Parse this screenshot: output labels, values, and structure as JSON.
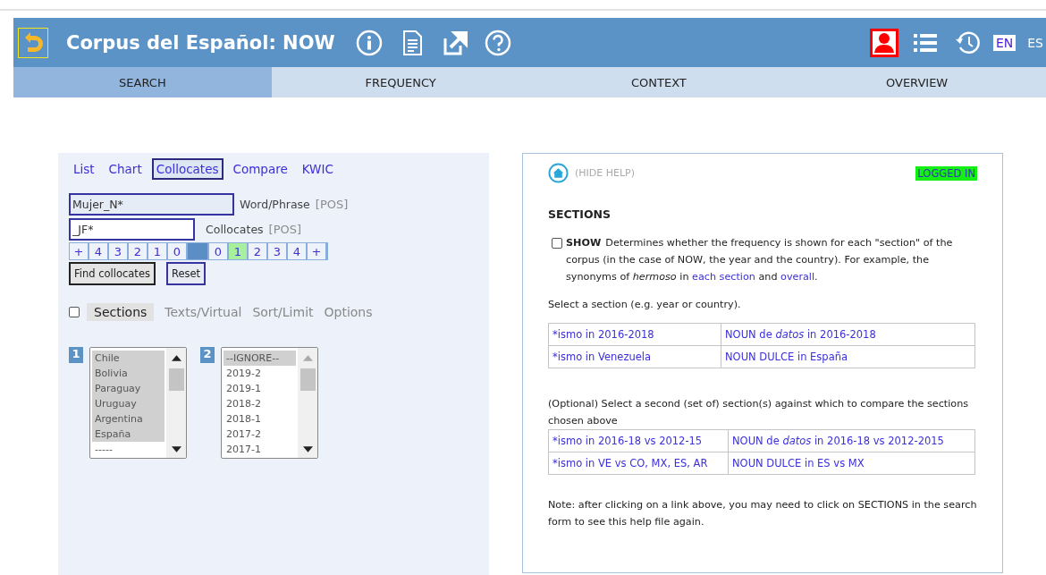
{
  "header": {
    "title": "Corpus del Español: NOW",
    "languages": [
      {
        "label": "EN",
        "selected": true
      },
      {
        "label": "ES",
        "selected": false
      }
    ]
  },
  "tabs": [
    {
      "label": "SEARCH",
      "selected": true
    },
    {
      "label": "FREQUENCY",
      "selected": false
    },
    {
      "label": "CONTEXT",
      "selected": false
    },
    {
      "label": "OVERVIEW",
      "selected": false
    }
  ],
  "search": {
    "modes": [
      {
        "label": "List",
        "selected": false
      },
      {
        "label": "Chart",
        "selected": false
      },
      {
        "label": "Collocates",
        "selected": true
      },
      {
        "label": "Compare",
        "selected": false
      },
      {
        "label": "KWIC",
        "selected": false
      }
    ],
    "fields": [
      {
        "value": "Mujer_N*",
        "label": "Word/Phrase",
        "pos": "[POS]"
      },
      {
        "value": "_JF*",
        "label": "Collocates",
        "pos": "[POS]"
      }
    ],
    "span_left": [
      {
        "label": "+",
        "selected": false
      },
      {
        "label": "4",
        "selected": false
      },
      {
        "label": "3",
        "selected": false
      },
      {
        "label": "2",
        "selected": false
      },
      {
        "label": "1",
        "selected": false
      },
      {
        "label": "0",
        "selected": false
      }
    ],
    "span_right": [
      {
        "label": "0",
        "selected": false
      },
      {
        "label": "1",
        "selected": true
      },
      {
        "label": "2",
        "selected": false
      },
      {
        "label": "3",
        "selected": false
      },
      {
        "label": "4",
        "selected": false
      },
      {
        "label": "+",
        "selected": false
      }
    ],
    "buttons": [
      "Find collocates",
      "Reset"
    ],
    "sections_checked": false,
    "options": [
      {
        "label": "Sections",
        "selected": true
      },
      {
        "label": "Texts/Virtual",
        "selected": false
      },
      {
        "label": "Sort/Limit",
        "selected": false
      },
      {
        "label": "Options",
        "selected": false
      }
    ],
    "lists": [
      {
        "number": "1",
        "items": [
          {
            "label": "Chile",
            "selected": true
          },
          {
            "label": "Bolivia",
            "selected": true
          },
          {
            "label": "Paraguay",
            "selected": true
          },
          {
            "label": "Uruguay",
            "selected": true
          },
          {
            "label": "Argentina",
            "selected": true
          },
          {
            "label": "España",
            "selected": true
          },
          {
            "label": "-----",
            "selected": false
          }
        ]
      },
      {
        "number": "2",
        "items": [
          {
            "label": "--IGNORE--",
            "selected": true
          },
          {
            "label": "2019-2",
            "selected": false
          },
          {
            "label": "2019-1",
            "selected": false
          },
          {
            "label": "2018-2",
            "selected": false
          },
          {
            "label": "2018-1",
            "selected": false
          },
          {
            "label": "2017-2",
            "selected": false
          },
          {
            "label": "2017-1",
            "selected": false
          }
        ]
      }
    ]
  },
  "help": {
    "hide": "(HIDE HELP)",
    "status": "LOGGED IN",
    "heading": "SECTIONS",
    "show": {
      "label": "SHOW",
      "checked": false
    },
    "intro": [
      {
        "kind": "text",
        "text": "Determines whether the frequency is shown for each \"section\" of the corpus (in the case of NOW, the year and the country). For example, the synonyms of *hermoso* in "
      },
      {
        "kind": "link",
        "text": "each section"
      },
      {
        "kind": "text",
        "text": " and "
      },
      {
        "kind": "link",
        "text": "overall"
      },
      {
        "kind": "text",
        "text": "."
      }
    ],
    "select_text": "Select a section (e.g. year or country).",
    "table1": [
      [
        "*ismo in 2016-2018",
        "NOUN de *datos* in 2016-2018"
      ],
      [
        "*ismo in Venezuela",
        "NOUN DULCE in España"
      ]
    ],
    "optional_text": "(Optional) Select a second (set of) section(s) against which to compare the sections chosen above",
    "table2": [
      [
        "*ismo in 2016-18 vs 2012-15",
        "NOUN de *datos* in 2016-18 vs 2012-2015"
      ],
      [
        "*ismo in VE vs CO, MX, ES, AR",
        "NOUN DULCE in ES vs MX"
      ]
    ],
    "note": "Note: after clicking on a link above, you may need to click on SECTIONS in the search form to see this help file again."
  }
}
